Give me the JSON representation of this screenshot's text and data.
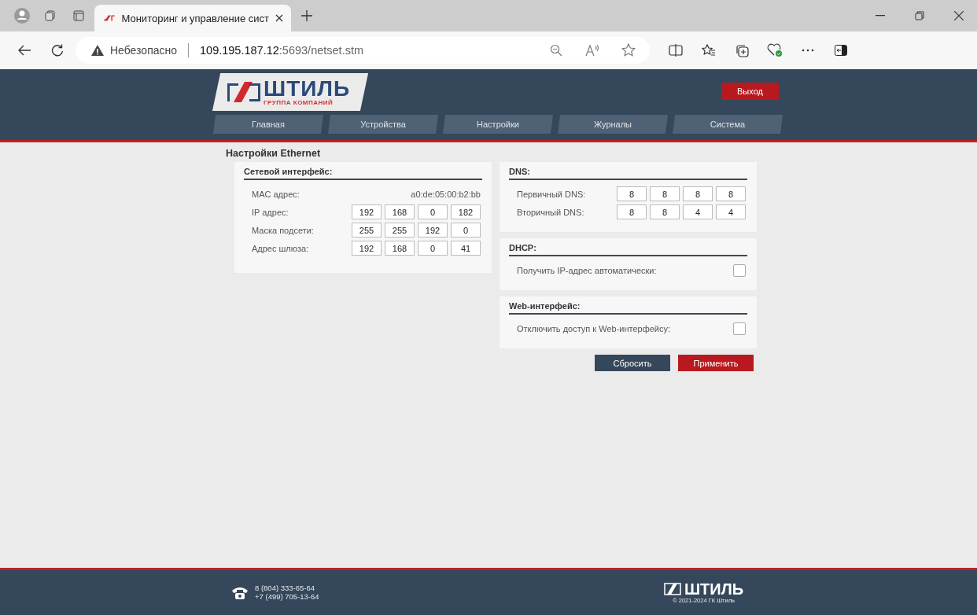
{
  "browser": {
    "tab_title": "Мониторинг и управление сист",
    "security": "Небезопасно",
    "url_host": "109.195.187.12",
    "url_rest": ":5693/netset.stm"
  },
  "header": {
    "logo_text": "ШТИЛЬ",
    "logo_sub": "ГРУППА КОМПАНИЙ",
    "logout": "Выход",
    "nav": [
      {
        "label": "Главная",
        "selected": false
      },
      {
        "label": "Устройства",
        "selected": false
      },
      {
        "label": "Настройки",
        "selected": false
      },
      {
        "label": "Журналы",
        "selected": false
      },
      {
        "label": "Система",
        "selected": false
      }
    ]
  },
  "page_title": "Настройки Ethernet",
  "network": {
    "title": "Сетевой интерфейс:",
    "mac_label": "MAC адрес:",
    "mac": "a0:de:05:00:b2:bb",
    "rows": [
      {
        "label": "IP адрес:",
        "octets": [
          "192",
          "168",
          "0",
          "182"
        ]
      },
      {
        "label": "Маска подсети:",
        "octets": [
          "255",
          "255",
          "192",
          "0"
        ]
      },
      {
        "label": "Адрес шлюза:",
        "octets": [
          "192",
          "168",
          "0",
          "41"
        ]
      }
    ]
  },
  "dns": {
    "title": "DNS:",
    "rows": [
      {
        "label": "Первичный DNS:",
        "octets": [
          "8",
          "8",
          "8",
          "8"
        ]
      },
      {
        "label": "Вторичный DNS:",
        "octets": [
          "8",
          "8",
          "4",
          "4"
        ]
      }
    ]
  },
  "dhcp": {
    "title": "DHCP:",
    "label": "Получить IP-адрес автоматически:",
    "checked": false
  },
  "web": {
    "title": "Web-интерфейс:",
    "label": "Отключить доступ к Web-интерфейсу:",
    "checked": false
  },
  "buttons": {
    "reset": "Сбросить",
    "apply": "Применить"
  },
  "footer": {
    "phones": [
      "8  (804) 333-65-64",
      "+7 (499) 705-13-64"
    ],
    "logo_text": "ШТИЛЬ",
    "copyright": "© 2021-2024 ГК Штиль"
  }
}
